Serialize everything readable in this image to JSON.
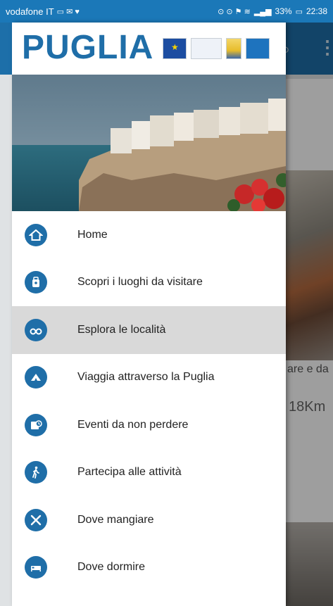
{
  "statusbar": {
    "carrier": "vodafone IT",
    "battery": "33%",
    "time": "22:38"
  },
  "background_app": {
    "snippet_text": "are e da",
    "distance_text": "18Km"
  },
  "drawer": {
    "logo_text": "PUGLIA",
    "colors": {
      "brand_blue": "#1f6ea8",
      "active_row": "#d9d9d9"
    },
    "items": [
      {
        "label": "Home",
        "icon": "home-icon",
        "active": false
      },
      {
        "label": "Scopri i luoghi da visitare",
        "icon": "map-pin-icon",
        "active": false
      },
      {
        "label": "Esplora le località",
        "icon": "binoculars-icon",
        "active": true
      },
      {
        "label": "Viaggia attraverso la Puglia",
        "icon": "travel-icon",
        "active": false
      },
      {
        "label": "Eventi da non perdere",
        "icon": "calendar-icon",
        "active": false
      },
      {
        "label": "Partecipa alle attività",
        "icon": "walking-person-icon",
        "active": false
      },
      {
        "label": "Dove mangiare",
        "icon": "fork-knife-icon",
        "active": false
      },
      {
        "label": "Dove dormire",
        "icon": "bed-icon",
        "active": false
      }
    ]
  }
}
